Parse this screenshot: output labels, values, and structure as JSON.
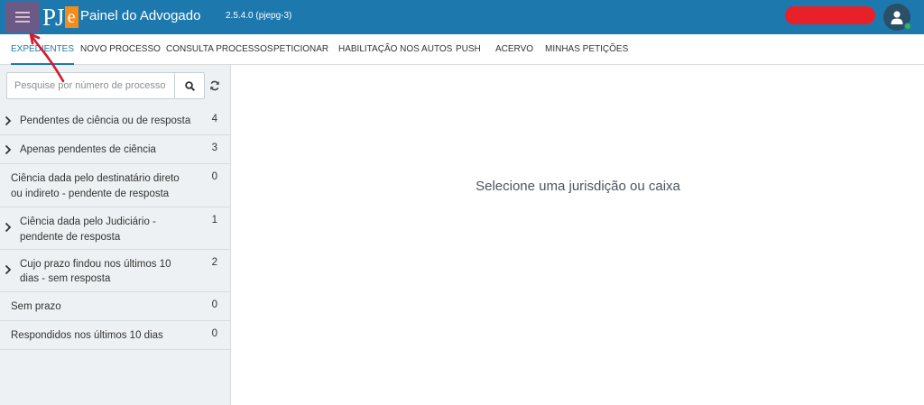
{
  "header": {
    "logo_text": "PJ",
    "logo_badge": "e",
    "title": "Painel do Advogado",
    "version": "2.5.4.0 (pjepg-3)"
  },
  "icons": {
    "menu": "hamburger-menu-icon",
    "search": "search-icon",
    "refresh": "refresh-icon",
    "avatar": "user-icon",
    "expand": "chevron-right-icon"
  },
  "colors": {
    "topbar": "#1d79ad",
    "menu_button": "#6b5a86",
    "logo_badge": "#f28c1b",
    "active_tab": "#1d79ad",
    "status_online": "#3bb54a",
    "redaction": "#e8202a",
    "annotation_arrow": "#d41a2a"
  },
  "nav": {
    "tabs": [
      {
        "label": "EXPEDIENTES",
        "active": true
      },
      {
        "label": "NOVO PROCESSO",
        "active": false
      },
      {
        "label": "CONSULTA PROCESSOS",
        "active": false
      },
      {
        "label": "PETICIONAR",
        "active": false
      },
      {
        "label": "HABILITAÇÃO NOS AUTOS",
        "active": false
      },
      {
        "label": "PUSH",
        "active": false
      },
      {
        "label": "ACERVO",
        "active": false
      },
      {
        "label": "MINHAS PETIÇÕES",
        "active": false
      }
    ]
  },
  "search": {
    "placeholder": "Pesquise por número de processo",
    "value": ""
  },
  "sidebar": {
    "items": [
      {
        "line1": "Pendentes de ciência ou de resposta",
        "line2": "",
        "count": "4",
        "expandable": true
      },
      {
        "line1": "Apenas pendentes de ciência",
        "line2": "",
        "count": "3",
        "expandable": true
      },
      {
        "line1": "Ciência dada pelo destinatário direto",
        "line2": "ou indireto - pendente de resposta",
        "count": "0",
        "expandable": false
      },
      {
        "line1": "Ciência dada pelo Judiciário -",
        "line2": "pendente de resposta",
        "count": "1",
        "expandable": true
      },
      {
        "line1": "Cujo prazo findou nos últimos 10",
        "line2": "dias - sem resposta",
        "count": "2",
        "expandable": true
      },
      {
        "line1": "Sem prazo",
        "line2": "",
        "count": "0",
        "expandable": false
      },
      {
        "line1": "Respondidos nos últimos 10 dias",
        "line2": "",
        "count": "0",
        "expandable": false
      }
    ]
  },
  "main": {
    "empty_message": "Selecione uma jurisdição ou caixa"
  }
}
